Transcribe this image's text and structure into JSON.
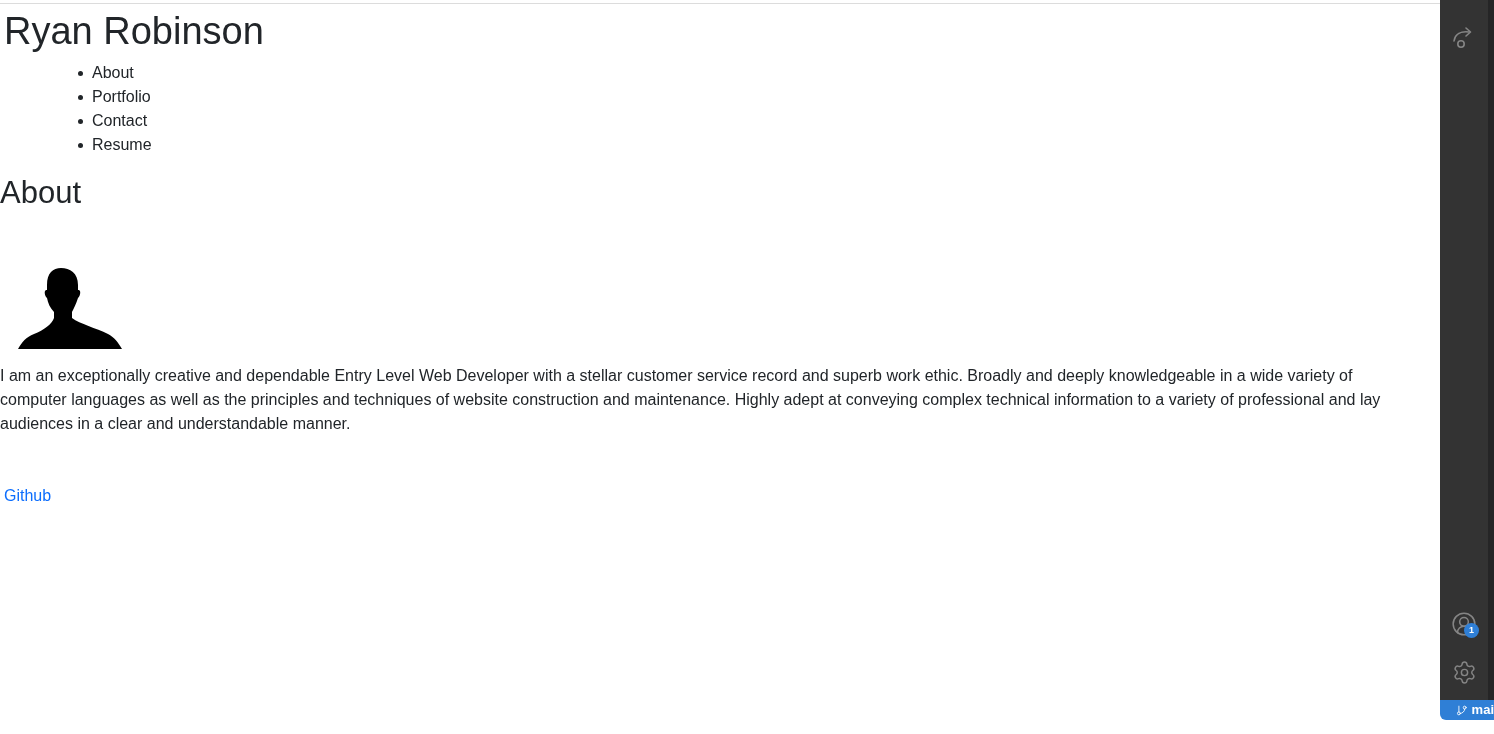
{
  "page": {
    "title": "Ryan Robinson",
    "nav": [
      {
        "label": "About"
      },
      {
        "label": "Portfolio"
      },
      {
        "label": "Contact"
      },
      {
        "label": "Resume"
      }
    ],
    "about": {
      "heading": "About",
      "bio": "I am an exceptionally creative and dependable Entry Level Web Developer with a stellar customer service record and superb work ethic. Broadly and deeply knowledgeable in a wide variety of computer languages as well as the principles and techniques of website construction and maintenance. Highly adept at conveying complex technical information to a variety of professional and lay audiences in a clear and understandable manner.",
      "links": [
        {
          "label": "Github"
        }
      ]
    }
  },
  "activity_bar": {
    "top_items": [
      {
        "kind": "share"
      }
    ],
    "bottom_items": [
      {
        "kind": "account",
        "badge": "1"
      },
      {
        "kind": "settings"
      }
    ]
  },
  "status_bar": {
    "branch": "mai"
  }
}
